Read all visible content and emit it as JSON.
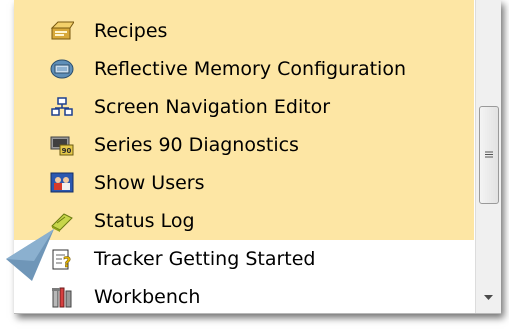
{
  "list": {
    "items": [
      {
        "label": "Recipes",
        "icon": "recipes-icon"
      },
      {
        "label": "Reflective Memory Configuration",
        "icon": "reflective-memory-icon"
      },
      {
        "label": "Screen Navigation Editor",
        "icon": "screen-navigation-icon"
      },
      {
        "label": "Series 90 Diagnostics",
        "icon": "series-90-diagnostics-icon"
      },
      {
        "label": "Show Users",
        "icon": "show-users-icon"
      },
      {
        "label": "Status Log",
        "icon": "status-log-icon"
      },
      {
        "label": "Tracker Getting Started",
        "icon": "tracker-help-icon"
      },
      {
        "label": "Workbench",
        "icon": "workbench-icon"
      }
    ],
    "icon_text": {
      "series90": "90"
    }
  },
  "colors": {
    "highlight": "#fde6a4",
    "pointer": "#6f96b8"
  }
}
